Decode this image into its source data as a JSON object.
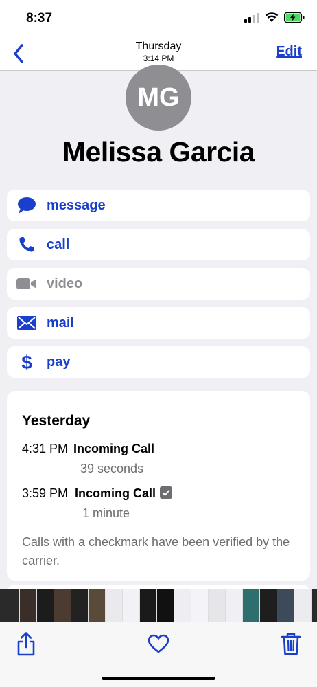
{
  "status_bar": {
    "time": "8:37"
  },
  "nav": {
    "day": "Thursday",
    "time": "3:14 PM",
    "edit_label": "Edit"
  },
  "contact": {
    "initials": "MG",
    "name": "Melissa Garcia"
  },
  "actions": [
    {
      "label": "message",
      "icon": "message-bubble-icon",
      "enabled": true
    },
    {
      "label": "call",
      "icon": "phone-icon",
      "enabled": true
    },
    {
      "label": "video",
      "icon": "video-camera-icon",
      "enabled": false
    },
    {
      "label": "mail",
      "icon": "envelope-icon",
      "enabled": true
    },
    {
      "label": "pay",
      "icon": "dollar-icon",
      "enabled": true
    }
  ],
  "recents": {
    "heading": "Yesterday",
    "calls": [
      {
        "time": "4:31 PM",
        "type": "Incoming Call",
        "duration": "39 seconds",
        "verified": false
      },
      {
        "time": "3:59 PM",
        "type": "Incoming Call",
        "duration": "1 minute",
        "verified": true
      }
    ],
    "note": "Calls with a checkmark have been verified by the carrier."
  },
  "colors": {
    "accent": "#1a3fcc",
    "secondary_text": "#6d6d72",
    "background": "#efeff4",
    "avatar": "#8e8e93"
  },
  "toolbar": {
    "share_icon": "share-icon",
    "favorite_icon": "heart-icon",
    "delete_icon": "trash-icon"
  }
}
